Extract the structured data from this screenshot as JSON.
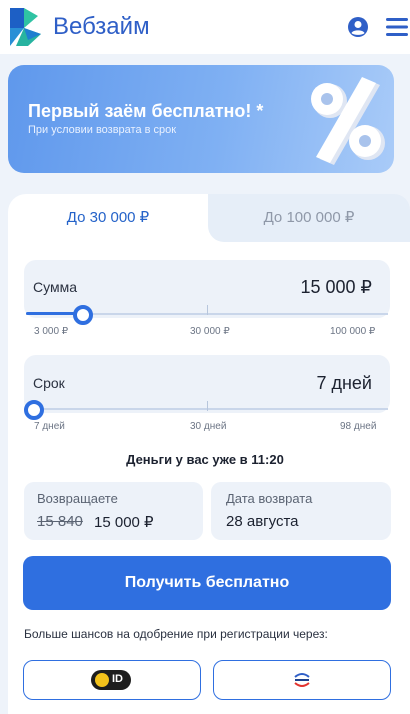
{
  "header": {
    "brand": "Вебзайм",
    "logo_icon": "vebzaim-logo-icon",
    "user_icon": "user-circle-icon",
    "menu_icon": "hamburger-menu-icon"
  },
  "promo": {
    "title": "Первый заём бесплатно! *",
    "subtitle": "При условии возврата в срок",
    "art": "percent-icon"
  },
  "tabs": [
    {
      "label": "До 30 000 ₽",
      "active": true
    },
    {
      "label": "До 100 000 ₽",
      "active": false
    }
  ],
  "amount": {
    "label": "Сумма",
    "value": "15 000 ₽",
    "scale": [
      "3 000 ₽",
      "30 000 ₽",
      "100 000 ₽"
    ],
    "position": 0.14
  },
  "term": {
    "label": "Срок",
    "value": "7 дней",
    "scale": [
      "7 дней",
      "30 дней",
      "98 дней"
    ],
    "position": 0.0
  },
  "ready": "Деньги у вас уже в 11:20",
  "return": {
    "label": "Возвращаете",
    "old": "15 840",
    "new": "15 000 ₽"
  },
  "date": {
    "label": "Дата возврата",
    "value": "28 августа"
  },
  "cta": "Получить бесплатно",
  "more": "Больше шансов на одобрение при регистрации через:",
  "social": {
    "yandex_id": "ID",
    "yandex_icon": "yandex-id-icon",
    "gos_icon": "gosuslugi-icon"
  },
  "colors": {
    "accent": "#2f6fe0",
    "brand": "#2f5fc7",
    "teal": "#27b3a0",
    "panel": "#edf2f9"
  }
}
